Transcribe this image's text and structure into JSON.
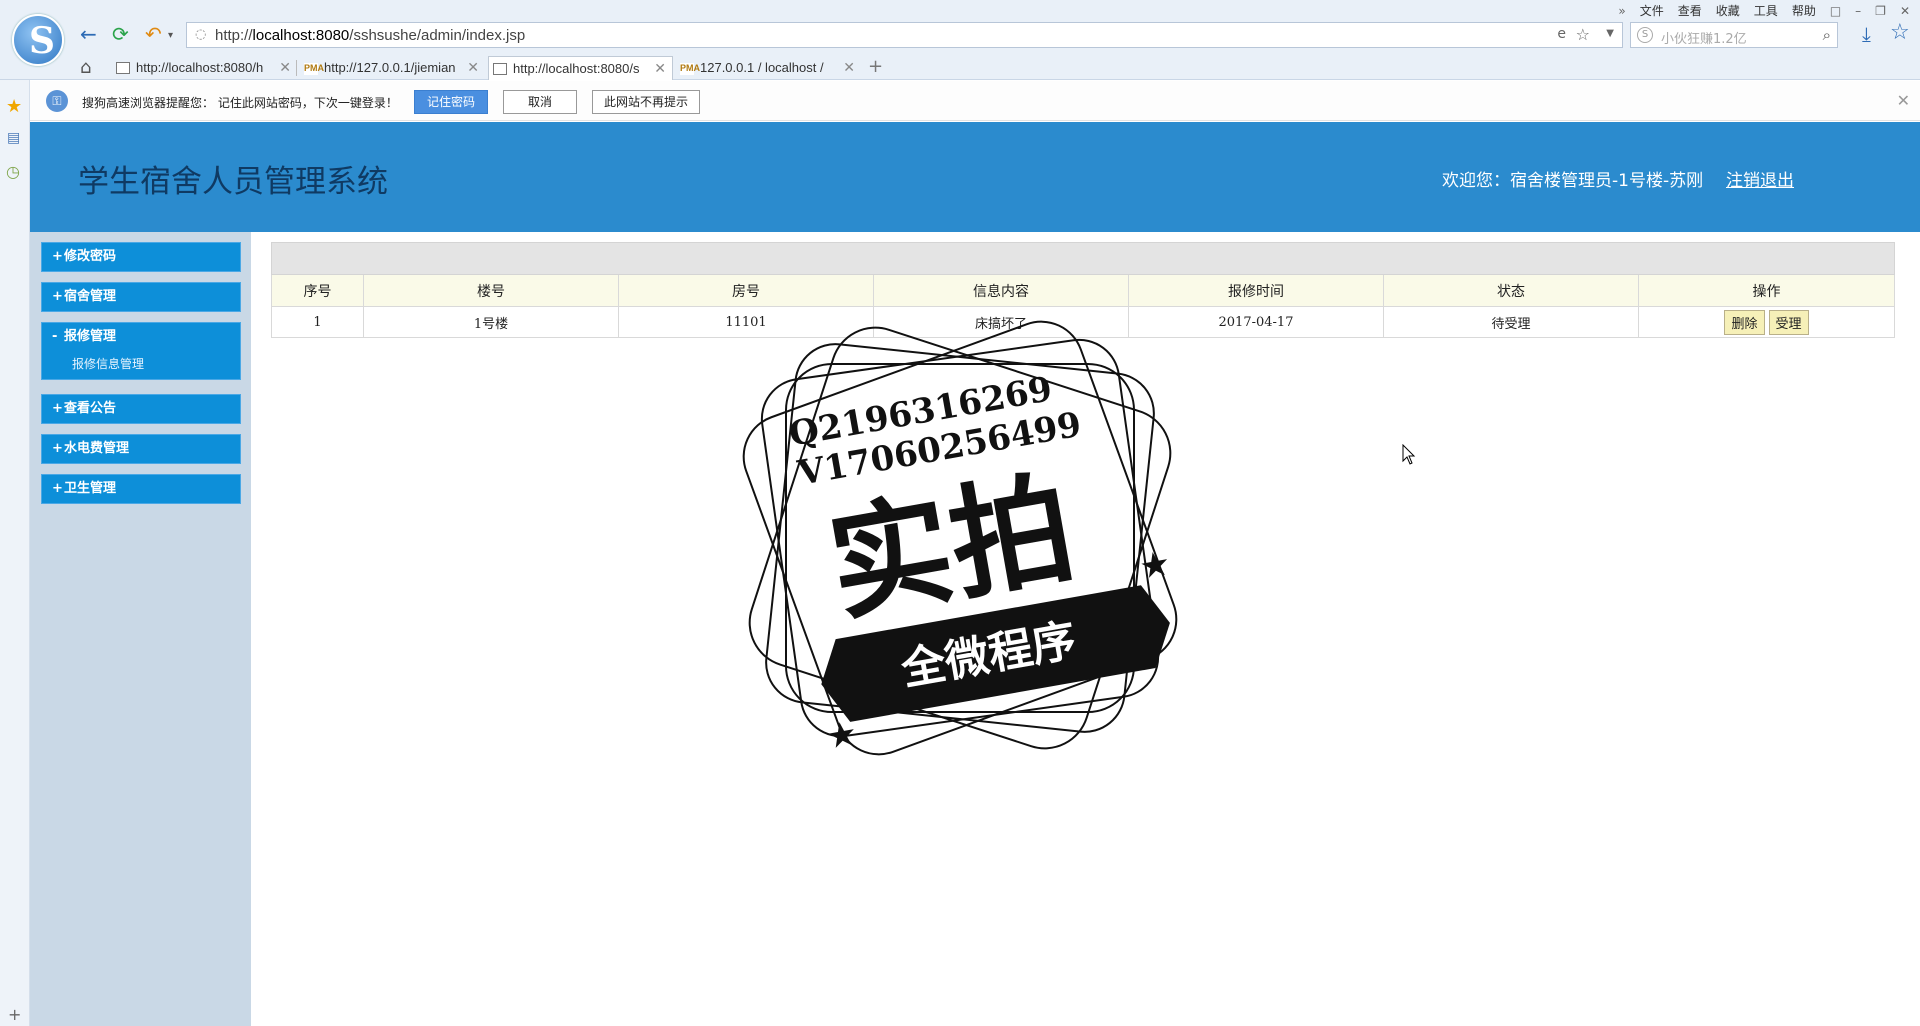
{
  "browser": {
    "url_prefix": "http://",
    "url_host": "localhost:8080",
    "url_path": "/sshsushe/admin/index.jsp",
    "search_placeholder": "小伙狂赚1.2亿",
    "menu": [
      "文件",
      "查看",
      "收藏",
      "工具",
      "帮助"
    ],
    "tabs": [
      {
        "label": "http://localhost:8080/h",
        "icon": "page-icon",
        "active": false
      },
      {
        "label": "http://127.0.0.1/jiemian",
        "icon": "pma-icon",
        "active": false
      },
      {
        "label": "http://localhost:8080/s",
        "icon": "page-icon",
        "active": true
      },
      {
        "label": "127.0.0.1 / localhost /",
        "icon": "pma-icon",
        "active": false
      }
    ]
  },
  "notice": {
    "message": "搜狗高速浏览器提醒您： 记住此网站密码，下次一键登录！",
    "remember": "记住密码",
    "cancel": "取消",
    "never": "此网站不再提示"
  },
  "header": {
    "title": "学生宿舍人员管理系统",
    "welcome": "欢迎您：宿舍楼管理员-1号楼-苏刚",
    "logout": "注销退出"
  },
  "menu": [
    {
      "label": "修改密码",
      "sign": "+",
      "sub": []
    },
    {
      "label": "宿舍管理",
      "sign": "+",
      "sub": []
    },
    {
      "label": "报修管理",
      "sign": "-",
      "sub": [
        "报修信息管理"
      ]
    },
    {
      "label": "查看公告",
      "sign": "+",
      "sub": []
    },
    {
      "label": "水电费管理",
      "sign": "+",
      "sub": []
    },
    {
      "label": "卫生管理",
      "sign": "+",
      "sub": []
    }
  ],
  "table": {
    "columns": [
      "序号",
      "楼号",
      "房号",
      "信息内容",
      "报修时间",
      "状态",
      "操作"
    ],
    "rows": [
      {
        "no": "1",
        "building": "1号楼",
        "room": "11101",
        "content": "床搞坏了",
        "time": "2017-04-17",
        "status": "待受理",
        "actions": [
          "删除",
          "受理"
        ]
      }
    ]
  },
  "watermark": {
    "line1": "Q2196316269",
    "line2": "V17060256499",
    "big": "实拍",
    "ribbon": "全微程序"
  }
}
